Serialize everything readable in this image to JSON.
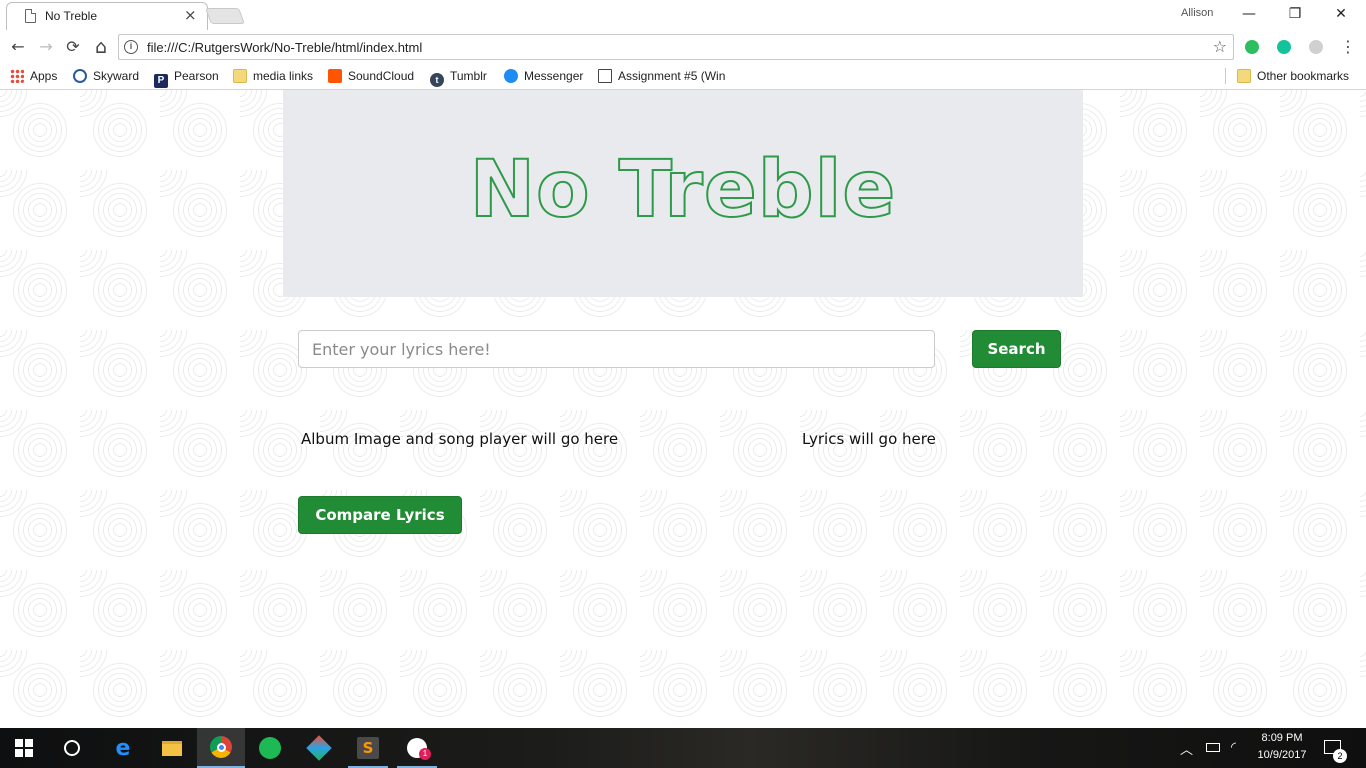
{
  "browser": {
    "tab_title": "No Treble",
    "tab_close": "×",
    "profile_name": "Allison",
    "window_controls": {
      "minimize": "—",
      "restore": "❐",
      "close": "✕"
    },
    "url": "file:///C:/RutgersWork/No-Treble/html/index.html",
    "nav": {
      "back": "←",
      "forward": "→",
      "reload": "⟳",
      "home": "⌂",
      "star": "☆",
      "menu": "⋮"
    },
    "extensions": [
      {
        "name": "evernote-icon",
        "color": "#2dbe60"
      },
      {
        "name": "grammarly-icon",
        "color": "#15c39a"
      },
      {
        "name": "extension-puzzle-icon",
        "color": "#c8c8c8"
      }
    ]
  },
  "bookmarks": {
    "items": [
      {
        "label": "Apps",
        "icon": "apps-grid-icon"
      },
      {
        "label": "Skyward",
        "icon": "skyward-icon"
      },
      {
        "label": "Pearson",
        "icon": "pearson-icon"
      },
      {
        "label": "media links",
        "icon": "folder-icon"
      },
      {
        "label": "SoundCloud",
        "icon": "soundcloud-icon"
      },
      {
        "label": "Tumblr",
        "icon": "tumblr-icon"
      },
      {
        "label": "Messenger",
        "icon": "messenger-icon"
      },
      {
        "label": "Assignment #5 (Win",
        "icon": "book-icon"
      }
    ],
    "other": "Other bookmarks"
  },
  "page": {
    "logo": "No Treble",
    "search": {
      "placeholder": "Enter your lyrics here!",
      "button": "Search"
    },
    "album_placeholder": "Album Image and song player will go here",
    "lyrics_placeholder": "Lyrics will go here",
    "compare_button": "Compare Lyrics",
    "accent_color": "#228b35",
    "logo_color": "#2e9a4a"
  },
  "taskbar": {
    "time": "8:09 PM",
    "date": "10/9/2017",
    "notification_count": "2",
    "badge_count": "1",
    "apps": [
      "start-icon",
      "cortana-icon",
      "edge-icon",
      "file-explorer-icon",
      "chrome-icon",
      "spotify-icon",
      "gitkraken-icon",
      "sublime-text-icon",
      "slack-icon"
    ]
  }
}
